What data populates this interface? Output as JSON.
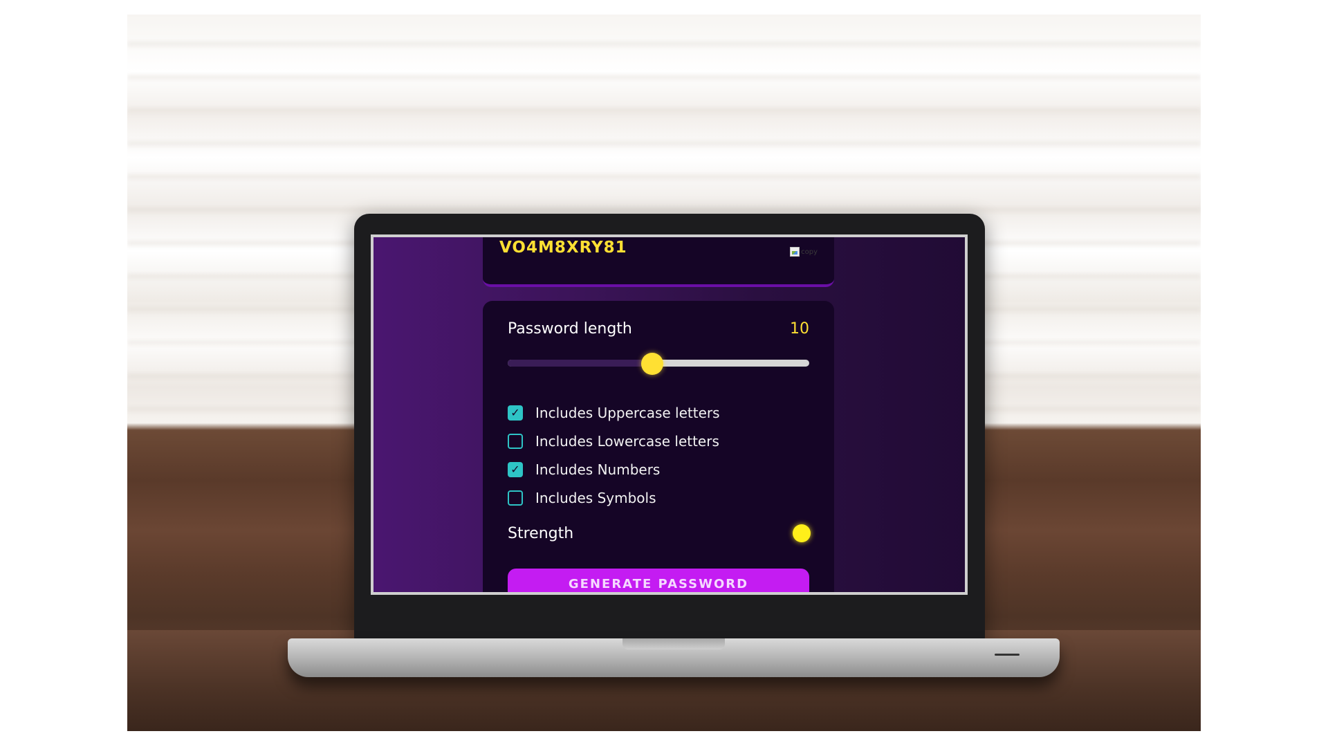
{
  "password": {
    "value": "VO4M8XRY81",
    "copy_alt": "copy"
  },
  "settings": {
    "length_label": "Password length",
    "length_value": "10",
    "slider_fraction": 0.48,
    "options": [
      {
        "label": "Includes Uppercase letters",
        "checked": true
      },
      {
        "label": "Includes Lowercase letters",
        "checked": false
      },
      {
        "label": "Includes Numbers",
        "checked": true
      },
      {
        "label": "Includes Symbols",
        "checked": false
      }
    ],
    "strength_label": "Strength",
    "generate_label": "GENERATE PASSWORD"
  },
  "colors": {
    "accent_yellow": "#ffe033",
    "checkbox_teal": "#2ec4c6",
    "button_magenta": "#c41cf2",
    "card_bg": "#150526"
  }
}
